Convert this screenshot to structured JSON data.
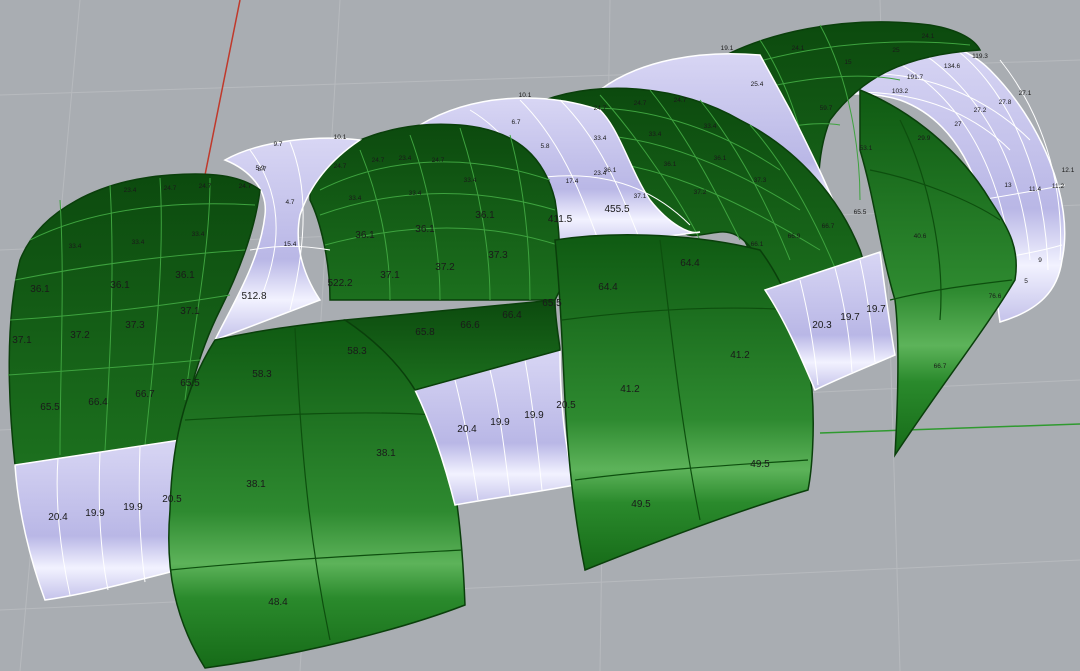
{
  "viewport": {
    "background": "#a9adb2",
    "grid_color": "#b9bcc0",
    "axis_x_color": "#2f9a2f",
    "axis_y_color": "#c0392b"
  },
  "surface": {
    "green_color": "#1f6f1f",
    "green_light_color": "#3a9a3a",
    "green_edge_color": "#0c4a0c",
    "lilac_color": "#c6c4ec",
    "lilac_edge_color": "#ffffff"
  },
  "labels": {
    "p1_top": [
      "23.4",
      "24.7",
      "24.7",
      "24.7"
    ],
    "p1_r1": [
      "33.4",
      "33.4",
      "33.4"
    ],
    "p1_r2": [
      "36.1",
      "36.1",
      "36.1"
    ],
    "p1_r3": [
      "37.1",
      "37.2",
      "37.3",
      "37.1"
    ],
    "p1_r4": [
      "65.5",
      "66.4",
      "66.7",
      "65.5"
    ],
    "b1": [
      "20.4",
      "19.9",
      "19.9",
      "20.5"
    ],
    "c1_top": [
      "10.1",
      "9.7",
      "8.7",
      "5.9",
      "4.7",
      "15.4"
    ],
    "c1_big": "512.8",
    "p2_top": [
      "24.7",
      "24.7",
      "23.4",
      "24.7"
    ],
    "p2_r1": [
      "33.4",
      "33.4",
      "33.4"
    ],
    "p2_r2": [
      "36.1",
      "36.1",
      "36.1"
    ],
    "p2_r3": [
      "37.1",
      "37.2",
      "37.3"
    ],
    "p2_r4": [
      "65.8",
      "66.6",
      "66.4",
      "65.5"
    ],
    "p2_big": "522.2",
    "g1": [
      "58.3",
      "58.3",
      "38.1",
      "38.1",
      "48.4"
    ],
    "b2": [
      "20.4",
      "19.9",
      "19.9",
      "20.5"
    ],
    "c2_top": [
      "10.1",
      "6.7",
      "5.8",
      "17.4",
      "23.4"
    ],
    "c2_big": [
      "411.5",
      "455.5"
    ],
    "p3_top": [
      "24.7",
      "24.7",
      "24.7"
    ],
    "p3_r1": [
      "33.4",
      "33.4",
      "33.4"
    ],
    "p3_r2": [
      "36.1",
      "36.1",
      "36.1"
    ],
    "p3_r3": [
      "37.1",
      "37.2",
      "37.3"
    ],
    "p3_r4": [
      "66.1",
      "66.9",
      "66.7",
      "65.5"
    ],
    "g2": [
      "64.4",
      "64.4",
      "41.2",
      "41.2",
      "49.5",
      "49.5"
    ],
    "b3": [
      "20.3",
      "19.7",
      "19.7"
    ],
    "c3_top": [
      "19.1",
      "25.4",
      "59.7",
      "53.1",
      "29.9"
    ],
    "p4_top": [
      "24.1",
      "15",
      "25",
      "24.1"
    ],
    "c4": [
      "119.3",
      "134.6",
      "191.7",
      "103.2",
      "27.8",
      "27.2",
      "27.1",
      "27",
      "12.1",
      "11.2",
      "11.4",
      "13",
      "9",
      "5"
    ],
    "g3": [
      "40.6",
      "76.6",
      "66.7"
    ]
  }
}
